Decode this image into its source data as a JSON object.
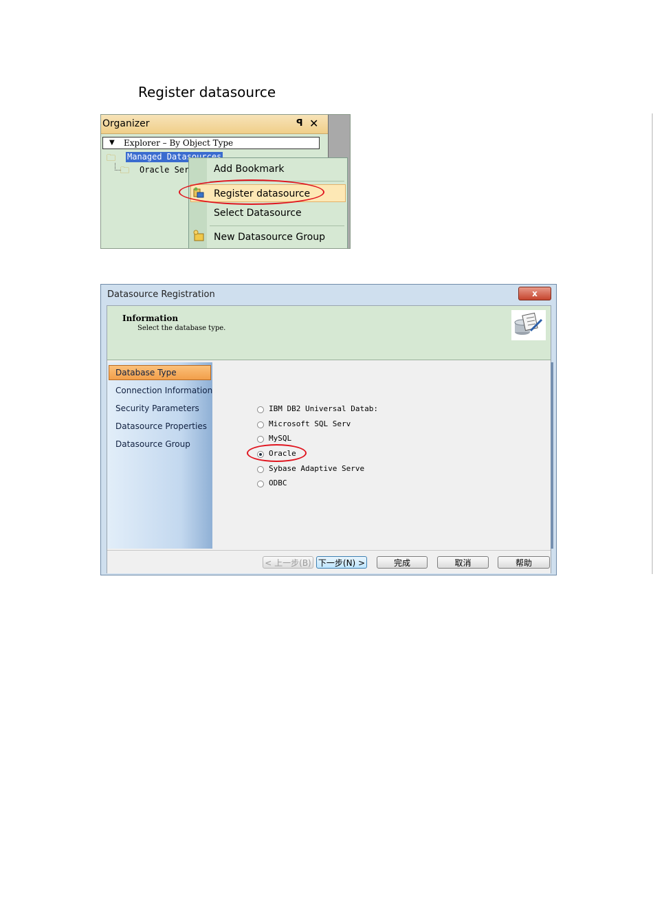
{
  "heading": "Register datasource",
  "organizer": {
    "title": "Organizer",
    "pin_glyph": "ꟼ",
    "close_glyph": "✕",
    "explorer_label": "Explorer – By Object Type",
    "tree": {
      "selected_node": "Managed Datasources",
      "child_node": "Oracle Ser"
    },
    "context_menu": [
      "Add Bookmark",
      "Register datasource",
      "Select Datasource",
      "New Datasource Group"
    ]
  },
  "dialog": {
    "title": "Datasource Registration",
    "close_glyph": "x",
    "info_title": "Information",
    "info_subtitle": "Select the database type.",
    "nav_items": [
      "Database Type",
      "Connection Information",
      "Security Parameters",
      "Datasource Properties",
      "Datasource Group"
    ],
    "selected_nav": "Database Type",
    "db_options": [
      "IBM DB2 Universal Datab:",
      "Microsoft SQL Serv",
      "MySQL",
      "Oracle",
      "Sybase Adaptive Serve",
      "ODBC"
    ],
    "selected_option": "Oracle",
    "buttons": {
      "back": "< 上一步(B)",
      "next": "下一步(N) >",
      "finish": "完成",
      "cancel": "取消",
      "help": "帮助"
    }
  },
  "annotation_color": "#e0141e"
}
